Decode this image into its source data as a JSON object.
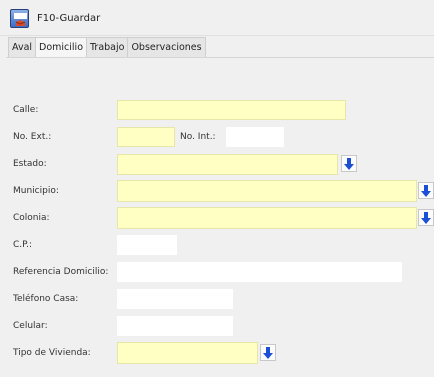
{
  "toolbar": {
    "save_label": "F10-Guardar"
  },
  "tabs": [
    {
      "label": "Aval"
    },
    {
      "label": "Domicilio"
    },
    {
      "label": "Trabajo"
    },
    {
      "label": "Observaciones"
    }
  ],
  "active_tab": "Domicilio",
  "form": {
    "calle": {
      "label": "Calle:",
      "value": "",
      "required": true
    },
    "no_ext": {
      "label": "No. Ext.:",
      "value": "",
      "required": true
    },
    "no_int": {
      "label": "No. Int.:",
      "value": ""
    },
    "estado": {
      "label": "Estado:",
      "value": "",
      "required": true
    },
    "municipio": {
      "label": "Municipio:",
      "value": "",
      "required": true
    },
    "colonia": {
      "label": "Colonia:",
      "value": "",
      "required": true
    },
    "cp": {
      "label": "C.P.:",
      "value": ""
    },
    "referencia": {
      "label": "Referencia Domicilio:",
      "value": ""
    },
    "telefono_casa": {
      "label": "Teléfono Casa:",
      "value": ""
    },
    "celular": {
      "label": "Celular:",
      "value": ""
    },
    "tipo_vivienda": {
      "label": "Tipo de Vivienda:",
      "value": "",
      "required": true
    }
  },
  "colors": {
    "required_bg": "#ffffc4",
    "dropdown_arrow": "#1a4fd6"
  }
}
